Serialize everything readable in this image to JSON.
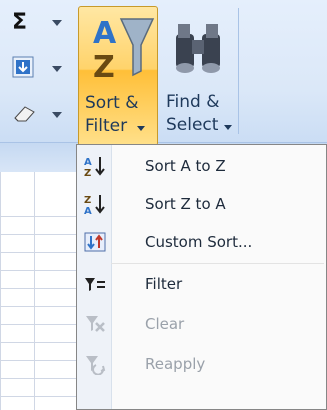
{
  "ribbon": {
    "sum_glyph": "Σ",
    "sort_filter": {
      "line1": "Sort &",
      "line2": "Filter"
    },
    "find_select": {
      "line1": "Find &",
      "line2": "Select"
    }
  },
  "menu": {
    "items": [
      {
        "label": "Sort A to Z",
        "icon": "sort-asc-icon",
        "enabled": true
      },
      {
        "label": "Sort Z to A",
        "icon": "sort-desc-icon",
        "enabled": true
      },
      {
        "label": "Custom Sort...",
        "icon": "custom-sort-icon",
        "enabled": true
      },
      {
        "label": "Filter",
        "icon": "filter-icon",
        "enabled": true
      },
      {
        "label": "Clear",
        "icon": "clear-filter-icon",
        "enabled": false
      },
      {
        "label": "Reapply",
        "icon": "reapply-icon",
        "enabled": false
      }
    ]
  },
  "colors": {
    "highlight": "#ffd36b",
    "menu_text": "#1e2b3c",
    "disabled_text": "#9aa1aa"
  }
}
